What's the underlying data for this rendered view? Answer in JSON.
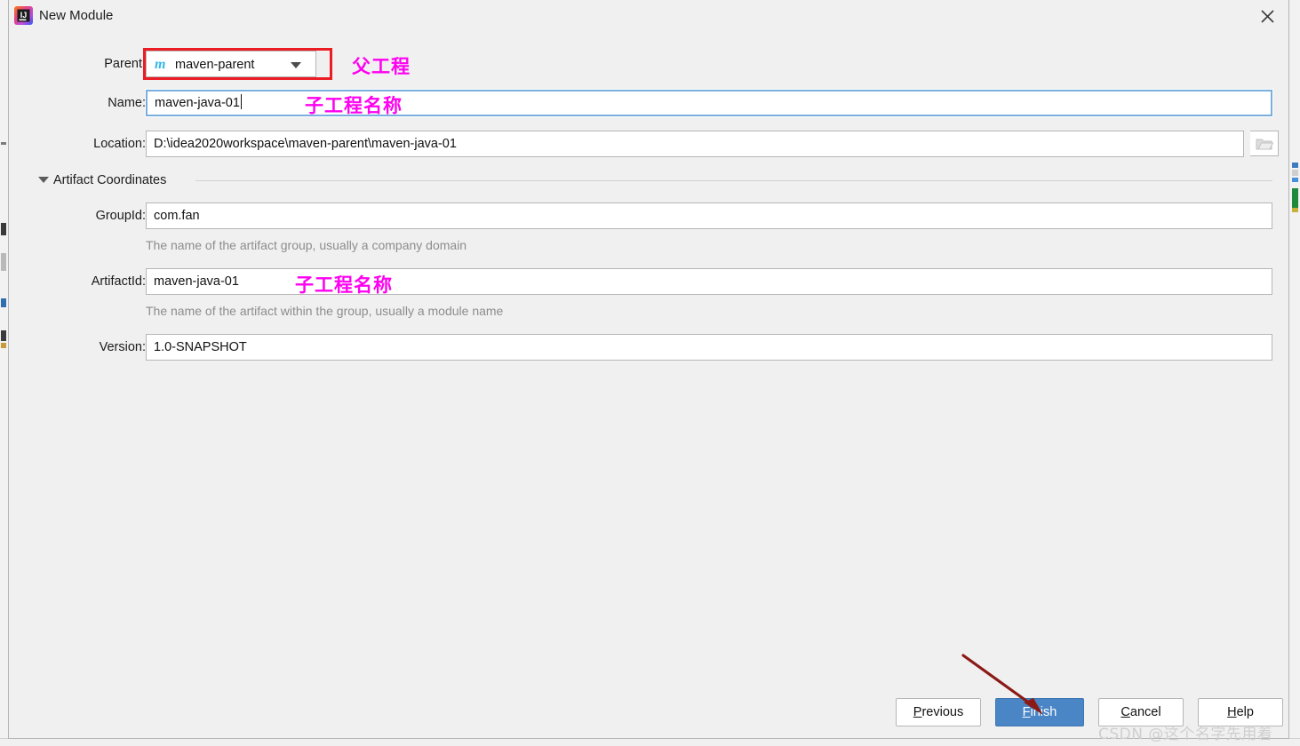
{
  "window": {
    "title": "New Module",
    "icon": "intellij-idea-logo",
    "close_icon": "close-icon",
    "background_color": "#f0f0f0"
  },
  "form": {
    "parent": {
      "label": "Parent:",
      "value": "maven-parent",
      "icon": "maven-module-icon",
      "icon_glyph": "m",
      "dropdown_icon": "chevron-down-icon",
      "annotation": {
        "text": "父工程",
        "color": "#ff00f0",
        "box_color": "#ec1c24"
      }
    },
    "name": {
      "label": "Name:",
      "value": "maven-java-01",
      "focused": true,
      "annotation": {
        "text": "子工程名称",
        "color": "#ff00f0"
      }
    },
    "location": {
      "label": "Location:",
      "value": "D:\\idea2020workspace\\maven-parent\\maven-java-01",
      "browse_icon": "folder-open-icon"
    }
  },
  "artifact_section": {
    "title": "Artifact Coordinates",
    "collapse_icon": "triangle-down-icon",
    "expanded": true,
    "fields": {
      "group_id": {
        "label": "GroupId:",
        "value": "com.fan",
        "hint": "The name of the artifact group, usually a company domain"
      },
      "artifact_id": {
        "label": "ArtifactId:",
        "value": "maven-java-01",
        "hint": "The name of the artifact within the group, usually a module name",
        "annotation": {
          "text": "子工程名称",
          "color": "#ff00f0"
        }
      },
      "version": {
        "label": "Version:",
        "value": "1.0-SNAPSHOT"
      }
    }
  },
  "buttons": {
    "previous": {
      "label_pre": "",
      "mnemonic": "P",
      "label_post": "revious"
    },
    "finish": {
      "label_pre": "",
      "mnemonic": "F",
      "label_post": "inish",
      "primary": true,
      "accent_color": "#4a86c5"
    },
    "cancel": {
      "label_pre": "",
      "mnemonic": "C",
      "label_post": "ancel"
    },
    "help": {
      "label_pre": "",
      "mnemonic": "H",
      "label_post": "elp"
    }
  },
  "annotations": {
    "finish_arrow": {
      "name": "red-arrow-to-finish",
      "color": "#8b1a16"
    }
  },
  "watermark": {
    "text": "CSDN @这个名字先用着"
  }
}
